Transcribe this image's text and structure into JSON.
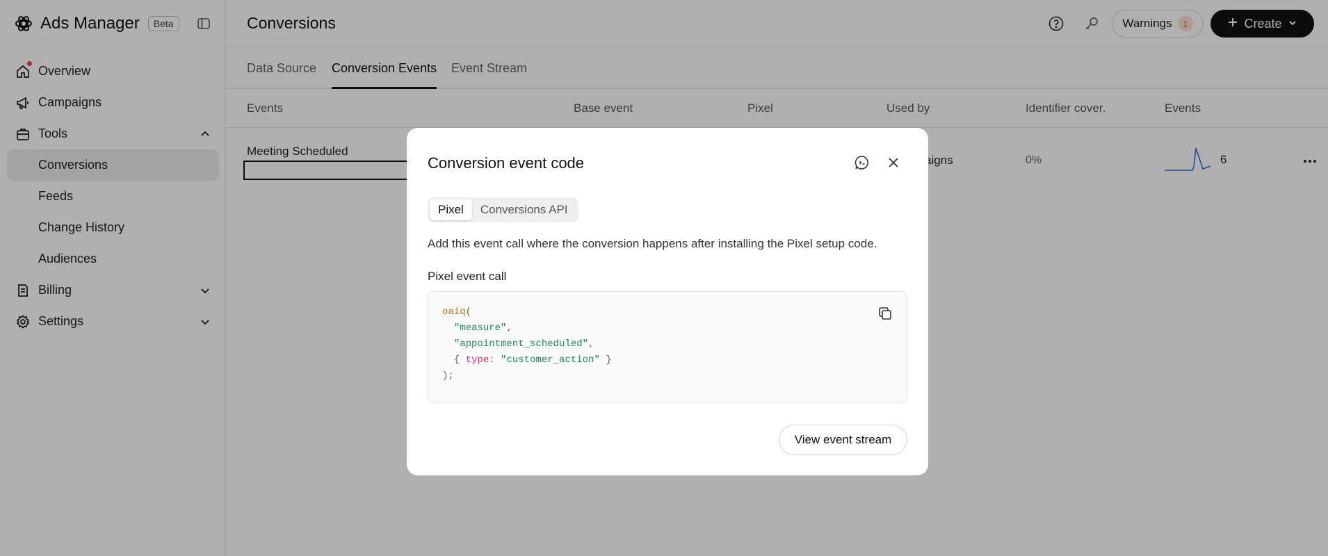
{
  "brand": {
    "name": "Ads Manager",
    "badge": "Beta"
  },
  "nav": {
    "overview": "Overview",
    "campaigns": "Campaigns",
    "tools": "Tools",
    "conversions": "Conversions",
    "feeds": "Feeds",
    "change_history": "Change History",
    "audiences": "Audiences",
    "billing": "Billing",
    "settings": "Settings"
  },
  "header": {
    "title": "Conversions",
    "warnings_label": "Warnings",
    "warnings_count": "1",
    "create_label": "Create"
  },
  "tabs": [
    "Data Source",
    "Conversion Events",
    "Event Stream"
  ],
  "table": {
    "columns": [
      "Events",
      "Base event",
      "Pixel",
      "Used by",
      "Identifier cover.",
      "Events"
    ],
    "row": {
      "name": "Meeting Scheduled",
      "used_by_visible": "aigns",
      "coverage": "0%",
      "events": "6"
    }
  },
  "modal": {
    "title": "Conversion event code",
    "tabs": [
      "Pixel",
      "Conversions API"
    ],
    "description": "Add this event call where the conversion happens after installing the Pixel setup code.",
    "code_label": "Pixel event call",
    "code": {
      "fn": "oaiq",
      "arg1": "\"measure\"",
      "arg2": "\"appointment_scheduled\"",
      "key": "type",
      "value": "\"customer_action\""
    },
    "view_button": "View event stream"
  },
  "colors": {
    "accent": "#111111",
    "sparkline": "#2f6fe0",
    "notification": "#e5484d",
    "code_string": "#1c8a4d",
    "code_fn": "#c2700d",
    "code_key": "#c4357a"
  }
}
